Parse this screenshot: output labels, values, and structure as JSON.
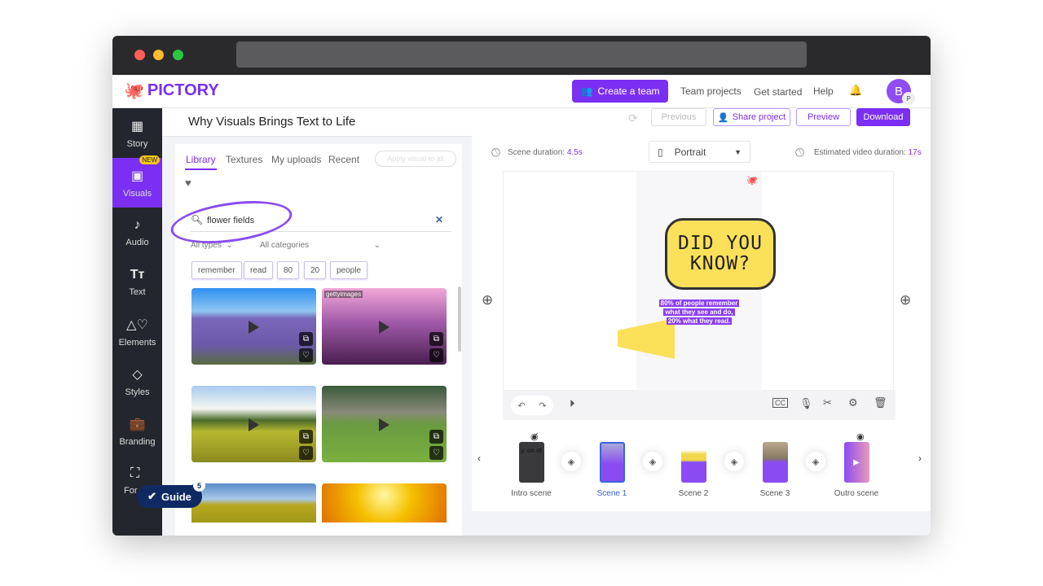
{
  "header": {
    "logo": "PICTORY",
    "create_team": "Create a team",
    "team_projects": "Team projects",
    "get_started": "Get started",
    "help": "Help",
    "avatar_initial": "B",
    "avatar_badge": "P"
  },
  "project": {
    "title": "Why Visuals Brings Text to Life",
    "previous": "Previous",
    "share": "Share project",
    "preview": "Preview",
    "download": "Download"
  },
  "sidebar": {
    "items": [
      {
        "label": "Story",
        "icon": "grid-icon"
      },
      {
        "label": "Visuals",
        "icon": "image-icon",
        "badge": "NEW"
      },
      {
        "label": "Audio",
        "icon": "music-icon"
      },
      {
        "label": "Text",
        "icon": "text-icon"
      },
      {
        "label": "Elements",
        "icon": "shapes-icon"
      },
      {
        "label": "Styles",
        "icon": "styles-icon"
      },
      {
        "label": "Branding",
        "icon": "briefcase-icon"
      },
      {
        "label": "For",
        "icon": "format-icon"
      }
    ]
  },
  "guide": {
    "label": "Guide",
    "count": "5"
  },
  "library": {
    "tabs": [
      "Library",
      "Textures",
      "My uploads",
      "Recent"
    ],
    "active_tab": "Library",
    "apply_all": "Apply visual to all",
    "search_value": "flower fields",
    "type_filter": "All types",
    "category_filter": "All categories",
    "chips": [
      "remember",
      "read",
      "80",
      "20",
      "people"
    ],
    "getty_label": "gettyimages"
  },
  "editor": {
    "scene_duration_label": "Scene duration:",
    "scene_duration": "4.5s",
    "orientation": "Portrait",
    "est_label": "Estimated video duration:",
    "est_duration": "17s",
    "headline1": "DID YOU",
    "headline2": "KNOW?",
    "caption": [
      "80% of people remember",
      "what they see and do,",
      "20% what they read."
    ]
  },
  "scenes": [
    {
      "label": "Intro scene",
      "text": "y. on ot"
    },
    {
      "label": "Scene 1",
      "active": true
    },
    {
      "label": "Scene 2"
    },
    {
      "label": "Scene 3"
    },
    {
      "label": "Outro scene"
    }
  ],
  "colors": {
    "accent": "#7b2ff2",
    "sidebar": "#23262e",
    "guide": "#0f2a63"
  }
}
